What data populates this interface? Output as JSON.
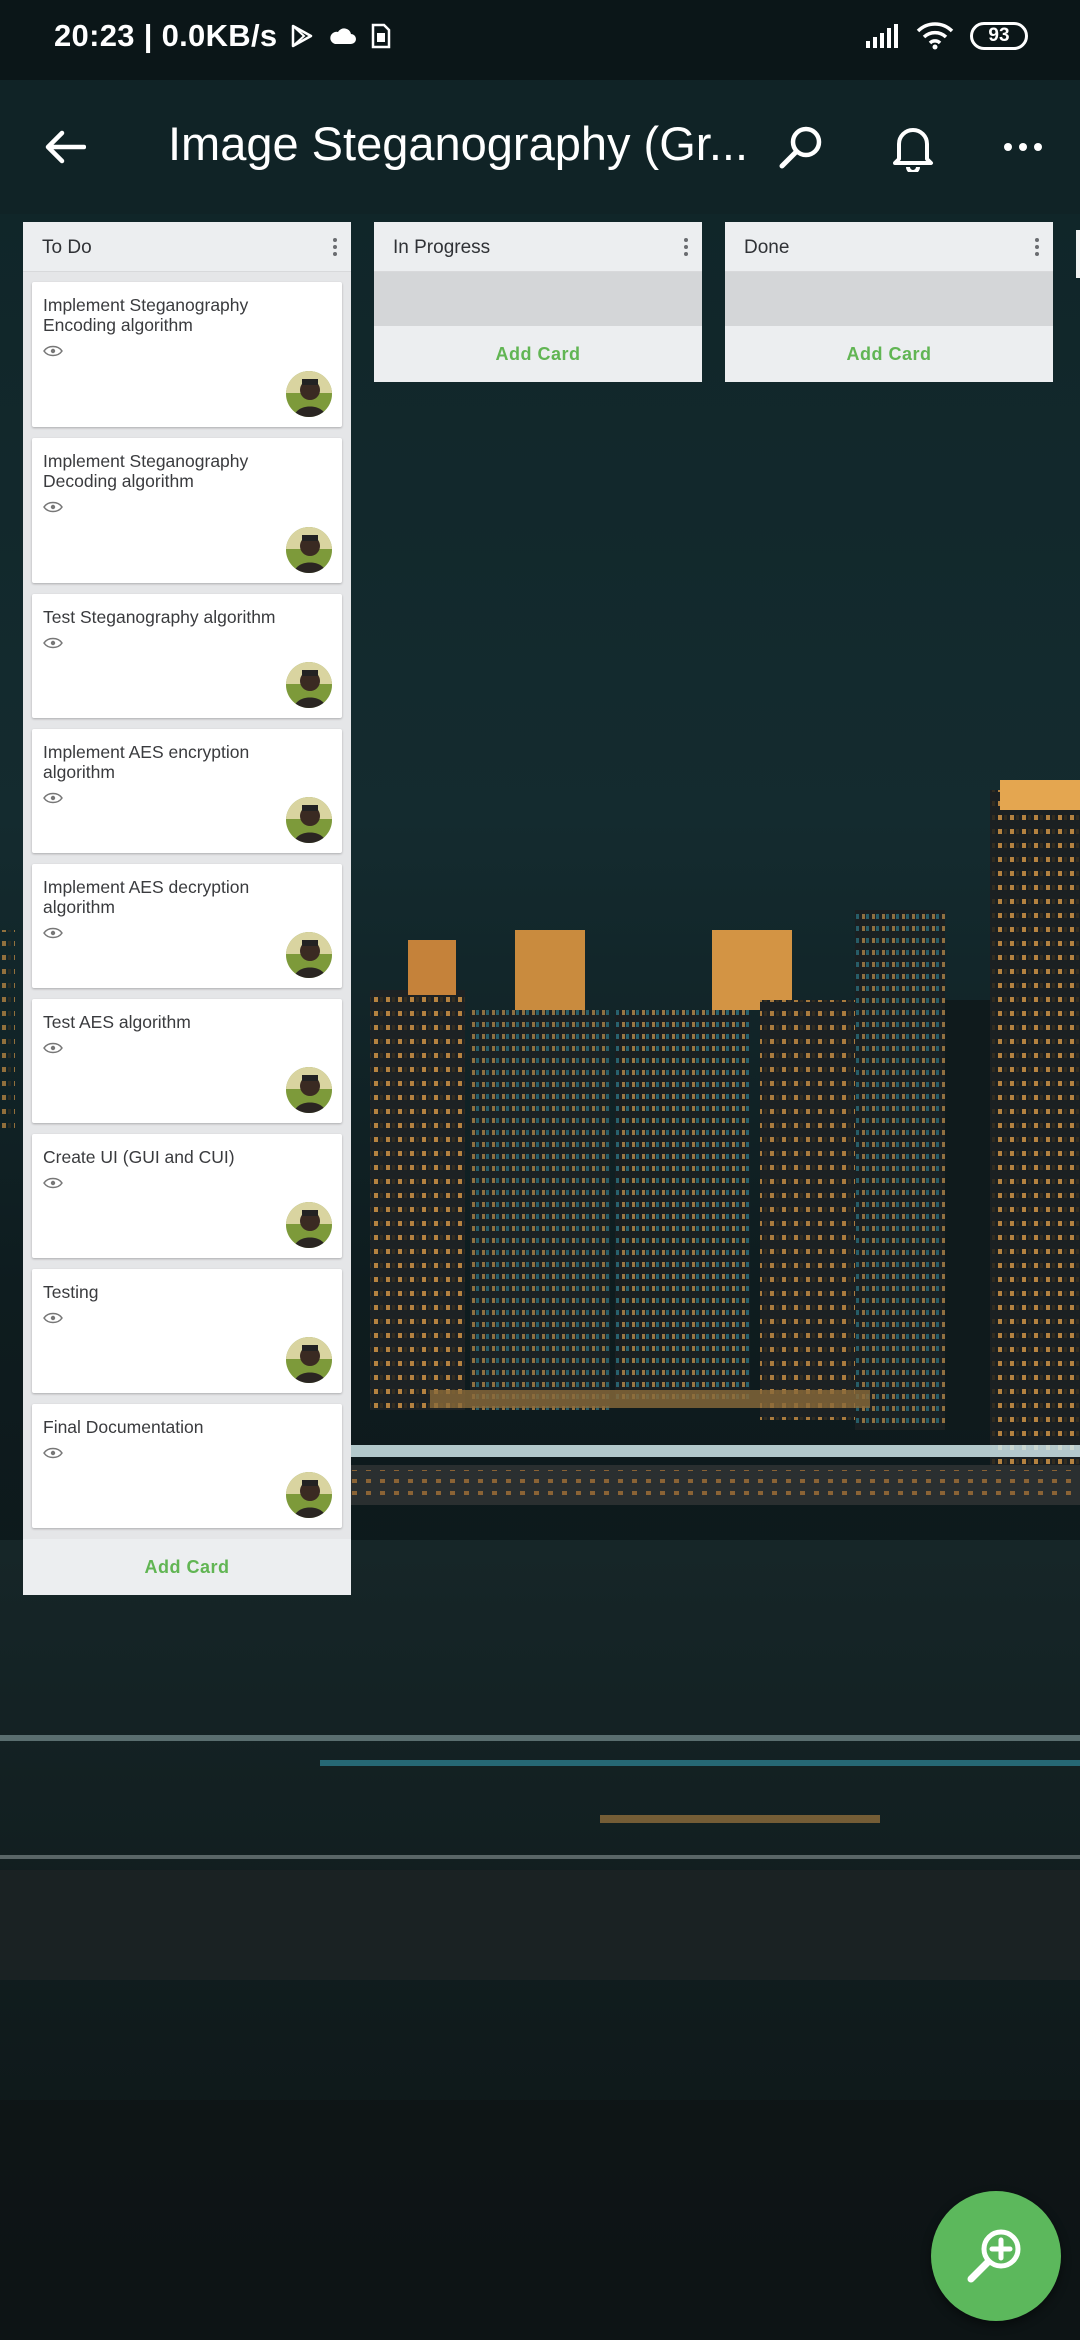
{
  "status_bar": {
    "time": "20:23 | 0.0KB/s",
    "battery": "93",
    "icons": [
      "play-store-icon",
      "cloud-icon",
      "sim-card-icon",
      "signal-icon",
      "wifi-icon",
      "battery-icon"
    ]
  },
  "app_bar": {
    "title": "Image Steganography (Gr...",
    "icons": [
      "back-arrow-icon",
      "search-icon",
      "bell-icon",
      "more-icon"
    ]
  },
  "lists": [
    {
      "title": "To Do",
      "add_label": "Add Card",
      "cards": [
        {
          "title": "Implement Steganography Encoding algorithm"
        },
        {
          "title": "Implement Steganography Decoding algorithm"
        },
        {
          "title": "Test Steganography algorithm"
        },
        {
          "title": "Implement AES encryption algorithm"
        },
        {
          "title": "Implement AES decryption algorithm"
        },
        {
          "title": "Test AES algorithm"
        },
        {
          "title": "Create UI (GUI and CUI)"
        },
        {
          "title": "Testing"
        },
        {
          "title": "Final Documentation"
        }
      ]
    },
    {
      "title": "In Progress",
      "add_label": "Add Card",
      "cards": []
    },
    {
      "title": "Done",
      "add_label": "Add Card",
      "cards": []
    }
  ],
  "fab": {
    "icon": "zoom-in-icon"
  },
  "colors": {
    "accent_green": "#5cb85c",
    "add_card_text": "#61b553",
    "app_bar": "#102326"
  }
}
